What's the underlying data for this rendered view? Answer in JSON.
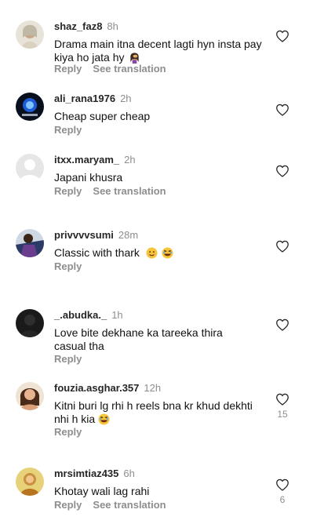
{
  "comments": [
    {
      "username": "shaz_faz8",
      "time": "8h",
      "text": "Drama main itna decent lagti hyn insta pay kiya ho jata hy",
      "emoji_icons": [
        "face-palm-woman-emoji"
      ],
      "reply_label": "Reply",
      "translate_label": "See translation",
      "likes": ""
    },
    {
      "username": "ali_rana1976",
      "time": "2h",
      "text": "Cheap super cheap",
      "emoji_icons": [],
      "reply_label": "Reply",
      "translate_label": "",
      "likes": ""
    },
    {
      "username": "itxx.maryam_",
      "time": "2h",
      "text": "Japani khusra",
      "emoji_icons": [],
      "reply_label": "Reply",
      "translate_label": "See translation",
      "likes": ""
    },
    {
      "username": "privvvvsumi",
      "time": "28m",
      "text": "Classic with thark",
      "emoji_icons": [
        "smiling-face-emoji",
        "laughing-face-emoji"
      ],
      "reply_label": "Reply",
      "translate_label": "",
      "likes": ""
    },
    {
      "username": "_.abudka._",
      "time": "1h",
      "text": "Love bite dekhane ka tareeka thira casual tha",
      "emoji_icons": [],
      "reply_label": "Reply",
      "translate_label": "",
      "likes": ""
    },
    {
      "username": "fouzia.asghar.357",
      "time": "12h",
      "text": "Kitni buri lg rhi h reels bna kr khud dekhti nhi h kia",
      "emoji_icons": [
        "laughing-face-emoji"
      ],
      "reply_label": "Reply",
      "translate_label": "",
      "likes": "15"
    },
    {
      "username": "mrsimtiaz435",
      "time": "6h",
      "text": "Khotay wali lag rahi",
      "emoji_icons": [],
      "reply_label": "Reply",
      "translate_label": "See translation",
      "likes": "6"
    }
  ],
  "colors": {
    "text": "#111111",
    "muted": "#8e8e8e",
    "username": "#262626",
    "background": "#ffffff"
  }
}
